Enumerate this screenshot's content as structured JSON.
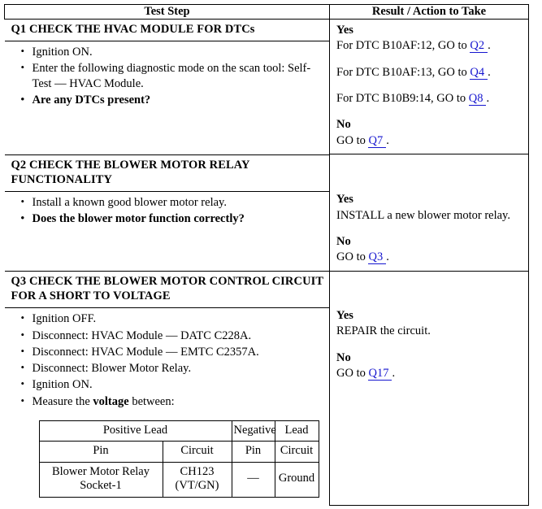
{
  "table": {
    "headers": {
      "test_step": "Test Step",
      "result_action": "Result / Action to Take"
    },
    "sections": [
      {
        "id": "Q1",
        "title": "Q1 CHECK THE HVAC MODULE FOR DTCs",
        "steps": [
          {
            "text": "Ignition ON.",
            "bold": false
          },
          {
            "text": "Enter the following diagnostic mode on the scan tool: Self-Test — HVAC Module.",
            "bold": false
          },
          {
            "text": "Are any DTCs present?",
            "bold": true
          }
        ],
        "result": {
          "yes_label": "Yes",
          "yes_lines": [
            {
              "prefix": "For DTC B10AF:12, GO to ",
              "link": "Q2",
              "suffix": "."
            },
            {
              "prefix": "For DTC B10AF:13, GO to ",
              "link": "Q4",
              "suffix": "."
            },
            {
              "prefix": "For DTC B10B9:14, GO to ",
              "link": "Q8",
              "suffix": "."
            }
          ],
          "no_label": "No",
          "no_lines": [
            {
              "prefix": "GO to ",
              "link": "Q7",
              "suffix": "."
            }
          ]
        }
      },
      {
        "id": "Q2",
        "title": "Q2 CHECK THE BLOWER MOTOR RELAY FUNCTIONALITY",
        "steps": [
          {
            "text": "Install a known good blower motor relay.",
            "bold": false
          },
          {
            "text": "Does the blower motor function correctly?",
            "bold": true
          }
        ],
        "result": {
          "yes_label": "Yes",
          "yes_lines": [
            {
              "prefix": "INSTALL a new blower motor relay.",
              "link": "",
              "suffix": ""
            }
          ],
          "no_label": "No",
          "no_lines": [
            {
              "prefix": "GO to ",
              "link": "Q3",
              "suffix": "."
            }
          ]
        }
      },
      {
        "id": "Q3",
        "title": "Q3 CHECK THE BLOWER MOTOR CONTROL CIRCUIT FOR A SHORT TO VOLTAGE",
        "steps": [
          {
            "text": "Ignition OFF.",
            "bold": false
          },
          {
            "text": "Disconnect: HVAC Module — DATC C228A.",
            "bold": false
          },
          {
            "text": "Disconnect: HVAC Module — EMTC C2357A.",
            "bold": false
          },
          {
            "text": "Disconnect: Blower Motor Relay.",
            "bold": false
          },
          {
            "text": "Ignition ON.",
            "bold": false
          },
          {
            "text": "Measure the voltage between:",
            "bold": false,
            "bold_word": "voltage"
          }
        ],
        "result": {
          "yes_label": "Yes",
          "yes_lines": [
            {
              "prefix": "REPAIR the circuit.",
              "link": "",
              "suffix": ""
            }
          ],
          "no_label": "No",
          "no_lines": [
            {
              "prefix": "GO to ",
              "link": "Q17",
              "suffix": "."
            }
          ]
        },
        "measurement_table": {
          "group_headers": [
            "Positive Lead",
            "Negative",
            "Lead"
          ],
          "sub_headers": [
            "Pin",
            "Circuit",
            "Pin",
            "Circuit"
          ],
          "rows": [
            {
              "positive_pin_line1": "Blower Motor Relay",
              "positive_pin_line2": "Socket-1",
              "positive_circuit_line1": "CH123",
              "positive_circuit_line2": "(VT/GN)",
              "negative_pin": "—",
              "negative_circuit": "Ground"
            }
          ]
        }
      }
    ]
  },
  "colors": {
    "link": "#1515cf",
    "border": "#000000",
    "text": "#000000",
    "background": "#ffffff"
  }
}
